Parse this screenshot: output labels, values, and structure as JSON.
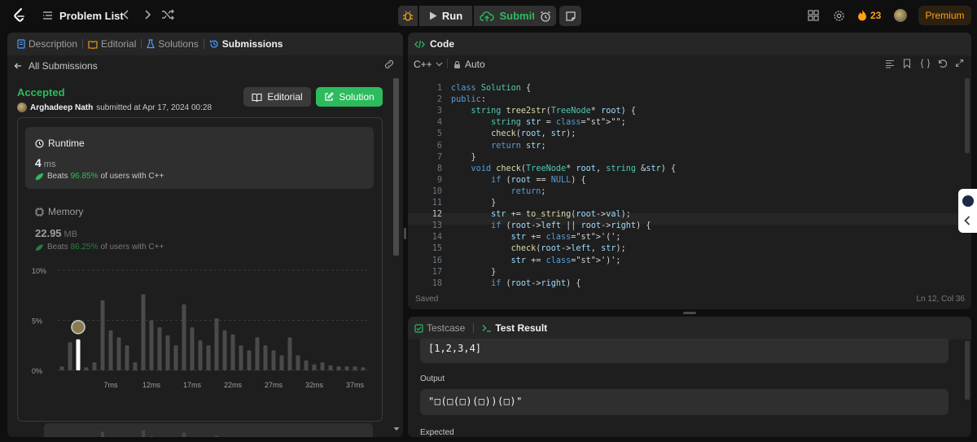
{
  "topbar": {
    "problem_list_label": "Problem List",
    "run_label": "Run",
    "submit_label": "Submit",
    "streak_count": "23",
    "premium_label": "Premium"
  },
  "left_panel": {
    "tabs": [
      {
        "label": "Description",
        "active": false
      },
      {
        "label": "Editorial",
        "active": false
      },
      {
        "label": "Solutions",
        "active": false
      },
      {
        "label": "Submissions",
        "active": true
      }
    ],
    "back_label": "All Submissions",
    "status": "Accepted",
    "author": "Arghadeep Nath",
    "submitted_text": "submitted at Apr 17, 2024 00:28",
    "editorial_button": "Editorial",
    "solution_button": "Solution",
    "runtime": {
      "title": "Runtime",
      "value": "4",
      "unit": "ms",
      "beats_label": "Beats",
      "beats_pct": "96.85%",
      "beats_suffix": "of users with C++"
    },
    "memory": {
      "title": "Memory",
      "value": "22.95",
      "unit": "MB",
      "beats_label": "Beats",
      "beats_pct": "86.25%",
      "beats_suffix": "of users with C++"
    }
  },
  "chart_data": {
    "type": "bar",
    "title": "",
    "ylabels": [
      "10%",
      "5%",
      "0%"
    ],
    "ylim": [
      0,
      10
    ],
    "xticks": [
      "7ms",
      "12ms",
      "17ms",
      "22ms",
      "27ms",
      "32ms",
      "37ms"
    ],
    "x": [
      1,
      2,
      3,
      4,
      5,
      6,
      7,
      8,
      9,
      10,
      11,
      12,
      13,
      14,
      15,
      16,
      17,
      18,
      19,
      20,
      21,
      22,
      23,
      24,
      25,
      26,
      27,
      28,
      29,
      30,
      31,
      32,
      33,
      34,
      35,
      36,
      37,
      38
    ],
    "values": [
      0.4,
      2.8,
      3.1,
      0.3,
      0.8,
      7.0,
      4.0,
      3.3,
      2.5,
      0.8,
      7.6,
      5.0,
      4.3,
      3.5,
      2.5,
      6.6,
      4.3,
      3.0,
      2.5,
      5.2,
      4.0,
      3.6,
      2.5,
      2.0,
      3.3,
      2.5,
      2.0,
      1.5,
      3.3,
      1.5,
      1.0,
      0.6,
      0.8,
      0.5,
      0.4,
      0.4,
      0.4,
      0.3
    ],
    "highlight_x": 3,
    "legend": "none",
    "grid": true
  },
  "code_panel": {
    "title": "Code",
    "language": "C++",
    "mode": "Auto",
    "saved_label": "Saved",
    "cursor_pos": "Ln 12, Col 36",
    "lines": [
      "class Solution {",
      "public:",
      "    string tree2str(TreeNode* root) {",
      "        string str = \"\";",
      "        check(root, str);",
      "        return str;",
      "    }",
      "    void check(TreeNode* root, string &str) {",
      "        if (root == NULL) {",
      "            return;",
      "        }",
      "        str += to_string(root->val);",
      "        if (root->left || root->right) {",
      "            str += '(';",
      "            check(root->left, str);",
      "            str += ')';",
      "        }",
      "        if (root->right) {"
    ],
    "line_numbers": [
      "1",
      "2",
      "3",
      "4",
      "5",
      "6",
      "7",
      "8",
      "9",
      "10",
      "11",
      "12",
      "13",
      "14",
      "15",
      "16",
      "17",
      "18"
    ]
  },
  "test_panel": {
    "tabs": [
      {
        "label": "Testcase",
        "active": false
      },
      {
        "label": "Test Result",
        "active": true
      }
    ],
    "input_value": "[1,2,3,4]",
    "output_label": "Output",
    "output_value": "\"□(□(□)(□))(□)\"",
    "expected_label": "Expected"
  },
  "colors": {
    "accent_green": "#2cbb5d",
    "premium_orange": "#ffa116",
    "background": "#0f0f0f",
    "panel": "#1e1e1e"
  }
}
